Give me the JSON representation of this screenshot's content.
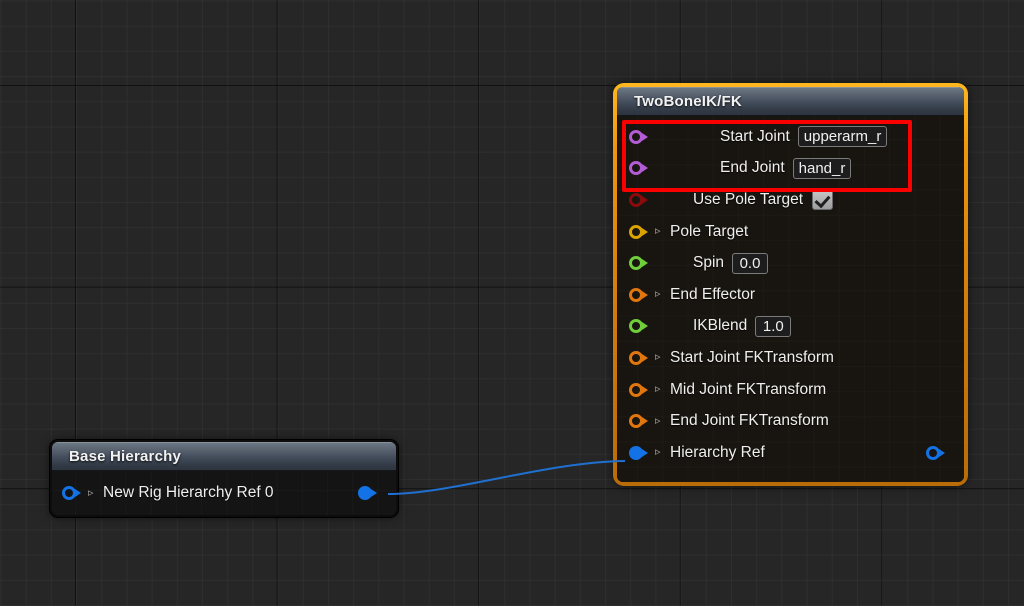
{
  "canvas": {
    "background_color": "#262626",
    "grid_minor_color": "#2e2e2e",
    "grid_major_color": "#151515"
  },
  "annotation": {
    "color": "#fb0000",
    "label": "highlighted-joint-fields"
  },
  "wire": {
    "color": "#1f70d0",
    "from": "base-hierarchy-output",
    "to": "hierarchy-ref-input"
  },
  "nodes": [
    {
      "id": "two-bone-ik-fk",
      "title": "TwoBoneIK/FK",
      "selected": true,
      "border_color": "#f0960e",
      "pins": [
        {
          "label": "Start Joint",
          "color": "#b45cd6",
          "shape": "hollow",
          "expandable": false,
          "widget": "text",
          "value": "upperarm_r"
        },
        {
          "label": "End Joint",
          "color": "#b45cd6",
          "shape": "hollow",
          "expandable": false,
          "widget": "text",
          "value": "hand_r"
        },
        {
          "label": "Use Pole Target",
          "color": "#8a0b0b",
          "shape": "hollow",
          "expandable": false,
          "widget": "checkbox",
          "value": "checked"
        },
        {
          "label": "Pole Target",
          "color": "#d9a300",
          "shape": "hollow",
          "expandable": true,
          "widget": "none",
          "value": ""
        },
        {
          "label": "Spin",
          "color": "#6fce3b",
          "shape": "hollow",
          "expandable": false,
          "widget": "number",
          "value": "0.0"
        },
        {
          "label": "End Effector",
          "color": "#e2760e",
          "shape": "hollow",
          "expandable": true,
          "widget": "none",
          "value": ""
        },
        {
          "label": "IKBlend",
          "color": "#6fce3b",
          "shape": "hollow",
          "expandable": false,
          "widget": "number",
          "value": "1.0"
        },
        {
          "label": "Start Joint FKTransform",
          "color": "#e2760e",
          "shape": "hollow",
          "expandable": true,
          "widget": "none",
          "value": ""
        },
        {
          "label": "Mid Joint FKTransform",
          "color": "#e2760e",
          "shape": "hollow",
          "expandable": true,
          "widget": "none",
          "value": ""
        },
        {
          "label": "End Joint FKTransform",
          "color": "#e2760e",
          "shape": "hollow",
          "expandable": true,
          "widget": "none",
          "value": ""
        },
        {
          "label": "Hierarchy Ref",
          "color": "#1373e6",
          "shape": "filled",
          "expandable": true,
          "widget": "none",
          "value": "",
          "output_pin": {
            "color": "#1373e6",
            "shape": "hollow"
          }
        }
      ]
    },
    {
      "id": "base-hierarchy",
      "title": "Base Hierarchy",
      "selected": false,
      "border_color": "#0d0d0d",
      "pins": [
        {
          "label": "New Rig Hierarchy Ref 0",
          "color": "#1373e6",
          "shape": "hollow",
          "expandable": true,
          "widget": "none",
          "value": "",
          "output_pin": {
            "color": "#1373e6",
            "shape": "filled"
          }
        }
      ]
    }
  ],
  "glyphs": {
    "expander": "▹"
  }
}
